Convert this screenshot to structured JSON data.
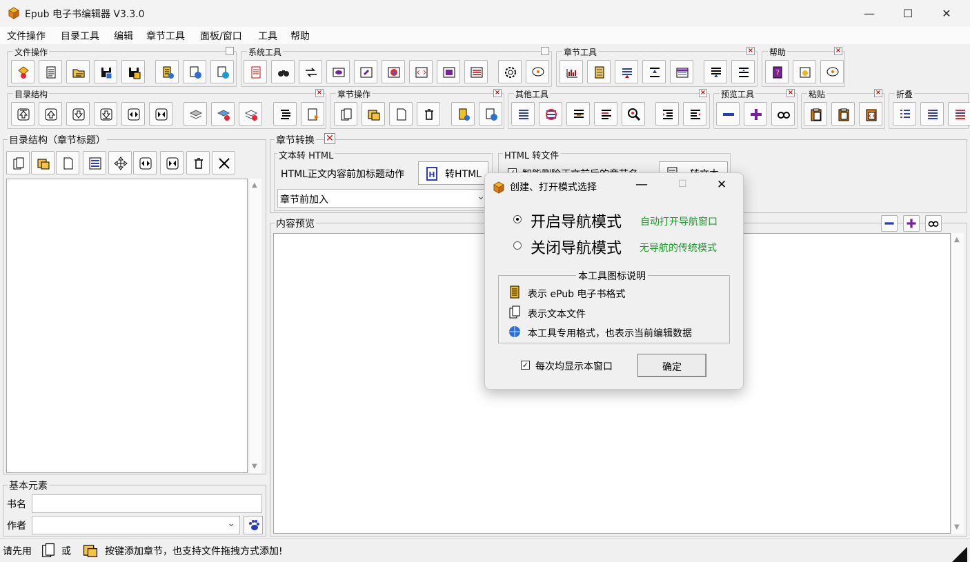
{
  "window": {
    "title": "Epub 电子书编辑器 V3.3.0",
    "minimize": "—",
    "maximize": "☐",
    "close": "✕"
  },
  "menu": [
    "文件操作",
    "目录工具",
    "编辑",
    "章节工具",
    "面板/窗口",
    "工具",
    "帮助"
  ],
  "toolbar_groups": {
    "file_ops": "文件操作",
    "system_tools": "系统工具",
    "chapter_tools": "章节工具",
    "help": "帮助",
    "toc_structure": "目录结构",
    "chapter_ops": "章节操作",
    "other_tools": "其他工具",
    "preview_tools": "预览工具",
    "paste": "粘贴",
    "fold": "折叠"
  },
  "left_panel": {
    "title": "目录结构（章节标题）",
    "basic_title": "基本元素",
    "book_name_label": "书名",
    "book_name_value": "",
    "author_label": "作者",
    "author_value": ""
  },
  "chapter_convert": {
    "tab_title": "章节转换",
    "text_to_html_title": "文本转 HTML",
    "action_label": "HTML正文内容前加标题动作",
    "convert_button": "转HTML",
    "select_value": "章节前加入",
    "html_to_file_title": "HTML 转文件",
    "checkbox_label": "智能删除正文前后的章节名",
    "to_text_button": "转文本"
  },
  "preview": {
    "title": "内容预览"
  },
  "dialog": {
    "title": "创建、打开模式选择",
    "option_on": "开启导航模式",
    "option_on_hint": "自动打开导航窗口",
    "option_off": "关闭导航模式",
    "option_off_hint": "无导航的传统模式",
    "selected": "on",
    "legend_title": "本工具图标说明",
    "legend_items": [
      "表示 ePub 电子书格式",
      "表示文本文件",
      "本工具专用格式，也表示当前编辑数据"
    ],
    "show_every_time": "每次均显示本窗口",
    "show_every_time_checked": true,
    "ok": "确定"
  },
  "status": {
    "prefix": "请先用",
    "or": "或",
    "suffix": "按键添加章节，也支持文件拖拽方式添加!"
  },
  "colors": {
    "accent_green": "#1a9a28",
    "close_red": "#d01010",
    "purple": "#7a1fa2",
    "blue": "#2a3db8"
  }
}
